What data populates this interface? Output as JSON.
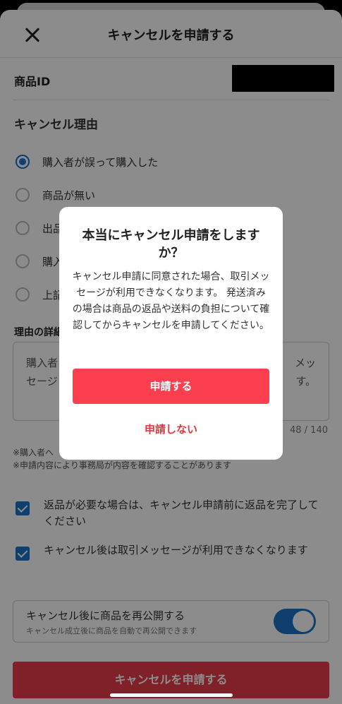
{
  "header": {
    "title": "キャンセルを申請する"
  },
  "product_id": {
    "label": "商品ID"
  },
  "reason": {
    "title": "キャンセル理由",
    "options": [
      {
        "label": "購入者が誤って購入した",
        "selected": true
      },
      {
        "label": "商品が無い",
        "selected": false
      },
      {
        "label": "出品",
        "selected": false
      },
      {
        "label": "購入",
        "selected": false
      },
      {
        "label": "上記",
        "selected": false
      }
    ]
  },
  "details": {
    "title": "理由の詳細",
    "text_line1": "購入者",
    "text_line1_end": "メッ",
    "text_line2": "セージ",
    "text_line2_end": "す。",
    "count": "48 / 140"
  },
  "notes": {
    "line1": "※購入者へ",
    "line2": "※申請内容により事務局が内容を確認することがあります"
  },
  "checks": [
    {
      "label": "返品が必要な場合は、キャンセル申請前に返品を完了してください",
      "checked": true
    },
    {
      "label": "キャンセル後は取引メッセージが利用できなくなります",
      "checked": true
    }
  ],
  "republish": {
    "title": "キャンセル後に商品を再公開する",
    "subtitle": "キャンセル成立後に商品を自動で再公開できます",
    "enabled": true
  },
  "submit": {
    "label": "キャンセルを申請する"
  },
  "modal": {
    "title": "本当にキャンセル申請をしますか？",
    "body": "キャンセル申請に同意された場合、取引メッセージが利用できなくなります。 発送済みの場合は商品の返品や送料の負担について確認してからキャンセルを申請してください。",
    "primary_label": "申請する",
    "secondary_label": "申請しない"
  },
  "colors": {
    "accent": "#1a73c8",
    "danger": "#fb3f4e"
  }
}
